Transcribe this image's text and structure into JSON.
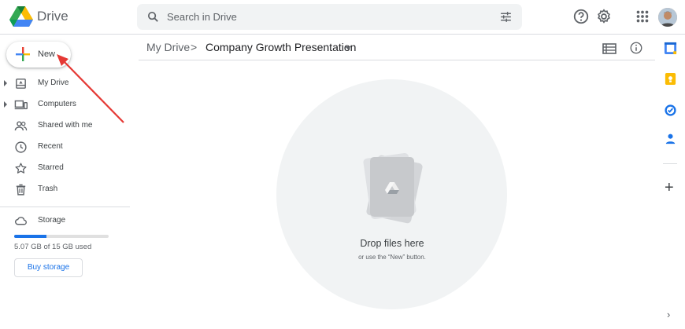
{
  "header": {
    "app_name": "Drive",
    "search_placeholder": "Search in Drive"
  },
  "sidebar": {
    "new_label": "New",
    "items": [
      {
        "label": "My Drive",
        "icon": "my-drive-icon",
        "expandable": true
      },
      {
        "label": "Computers",
        "icon": "computers-icon",
        "expandable": true
      },
      {
        "label": "Shared with me",
        "icon": "shared-icon",
        "expandable": false
      },
      {
        "label": "Recent",
        "icon": "clock-icon",
        "expandable": false
      },
      {
        "label": "Starred",
        "icon": "star-icon",
        "expandable": false
      },
      {
        "label": "Trash",
        "icon": "trash-icon",
        "expandable": false
      }
    ],
    "storage": {
      "label": "Storage",
      "used_text": "5.07 GB of 15 GB used",
      "used_fraction": 0.338,
      "buy_label": "Buy storage"
    }
  },
  "breadcrumb": {
    "root": "My Drive",
    "separator": ">",
    "current": "Company Growth Presentation"
  },
  "empty_state": {
    "title": "Drop files here",
    "subtitle": "or use the “New” button."
  },
  "colors": {
    "accent": "#1a73e8",
    "annotation_arrow": "#e53935"
  }
}
